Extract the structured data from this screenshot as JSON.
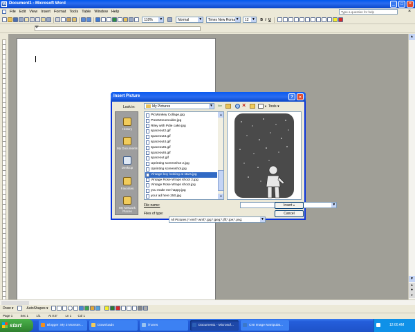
{
  "window": {
    "title": "Document1 - Microsoft Word"
  },
  "menu": [
    "File",
    "Edit",
    "View",
    "Insert",
    "Format",
    "Tools",
    "Table",
    "Window",
    "Help"
  ],
  "help_box": "Type a question for help",
  "toolbar": {
    "zoom": "110%",
    "style": "Normal",
    "font": "Times New Roman",
    "size": "12",
    "bold": "B",
    "italic": "I",
    "underline": "U"
  },
  "dialog": {
    "title": "Insert Picture",
    "lookin_label": "Look in:",
    "lookin_value": "My Pictures",
    "tools_label": "Tools",
    "places": [
      "History",
      "My Documents",
      "Desktop",
      "Favorites",
      "My Network Places"
    ],
    "files": [
      "PicMonkey Collage.jpg",
      "PreeMonomoider.jpg",
      "Riley with Pdie cake.jpg",
      "spaceout2.gif",
      "spaceout3.gif",
      "spaceout4.gif",
      "spaceout5.gif",
      "spaceout6.gif",
      "spaceout.gif",
      "Uprinting screenshot 2.jpg",
      "Uprinting screenshot.jpg",
      "Vintage boy looking at stars.jpg",
      "Vintage Rose Wraps shoot 2.jpg",
      "Vintage Rose Wraps shoot.jpg",
      "you make me happy.jpg",
      "your ad here 250.jpg"
    ],
    "selected_index": 11,
    "filename_label": "File name:",
    "filename_value": "",
    "filetype_label": "Files of type:",
    "filetype_value": "All Pictures (*.emf;*.wmf;*.jpg;*.jpeg;*.jfif;*.jpe;*.png;",
    "insert_label": "Insert",
    "cancel_label": "Cancel"
  },
  "drawing_toolbar": {
    "draw": "Draw",
    "autoshapes": "AutoShapes"
  },
  "status": {
    "page": "Page 1",
    "sec": "Sec 1",
    "pos": "1/1",
    "at": "At 0.5\"",
    "ln": "Ln 1",
    "col": "Col 1"
  },
  "taskbar": {
    "start": "start",
    "items": [
      "Blogger: My 3 Monster...",
      "Downloads",
      "iTunes",
      "Document1 - Microsof...",
      "CNI Image Manipulat..."
    ],
    "active_index": 3,
    "clock": "12:00 AM"
  },
  "colors": {
    "title_blue": "#0a246a",
    "taskbar_blue": "#245edb",
    "start_green": "#3c9a3c",
    "page_gray": "#a09f97"
  }
}
